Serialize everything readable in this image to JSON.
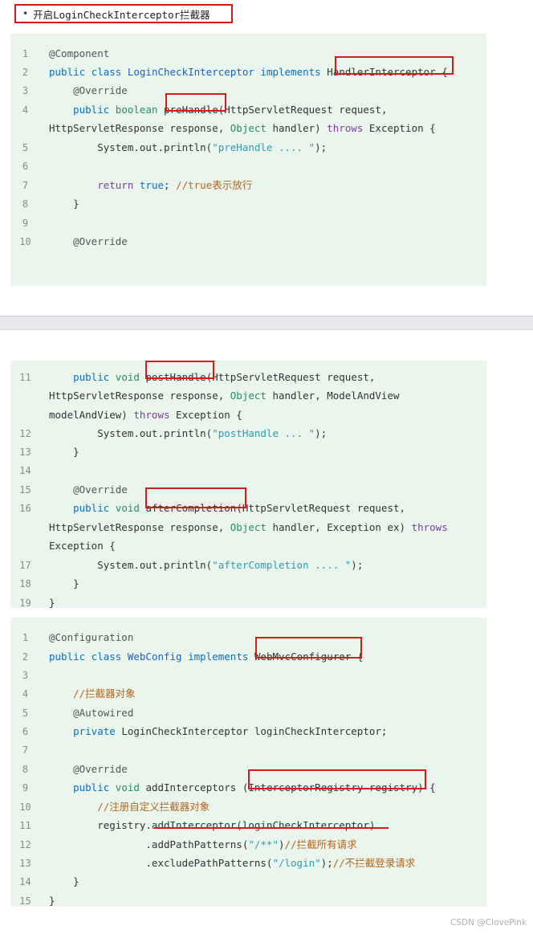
{
  "header": {
    "bullet": "•",
    "text": "开启LoginCheckInterceptor拦截器"
  },
  "block1": [
    {
      "n": "1",
      "parts": [
        [
          "ann",
          "@Component"
        ]
      ]
    },
    {
      "n": "2",
      "parts": [
        [
          "kw2",
          "public "
        ],
        [
          "kw2",
          "class "
        ],
        [
          "cls",
          "LoginCheckInterceptor "
        ],
        [
          "kw2",
          "implements "
        ],
        [
          "plain",
          "HandlerInterceptor"
        ],
        [
          "plain",
          " {"
        ]
      ]
    },
    {
      "n": "3",
      "parts": [
        [
          "ann",
          "    @Override"
        ]
      ]
    },
    {
      "n": "4",
      "parts": [
        [
          "kw2",
          "    public "
        ],
        [
          "ty",
          "boolean "
        ],
        [
          "plain",
          "preHandle"
        ],
        [
          "plain",
          "(HttpServletRequest request,"
        ]
      ]
    },
    {
      "n": "",
      "parts": [
        [
          "plain",
          "HttpServletResponse response, "
        ],
        [
          "ty",
          "Object "
        ],
        [
          "plain",
          "handler) "
        ],
        [
          "kw",
          "throws "
        ],
        [
          "plain",
          "Exception {"
        ]
      ]
    },
    {
      "n": "5",
      "parts": [
        [
          "plain",
          "        System.out.println("
        ],
        [
          "str",
          "\"preHandle .... \""
        ],
        [
          "plain",
          ");"
        ]
      ]
    },
    {
      "n": "6",
      "parts": []
    },
    {
      "n": "7",
      "parts": [
        [
          "kw",
          "        return "
        ],
        [
          "kw2",
          "true"
        ],
        [
          "plain",
          "; "
        ],
        [
          "cm",
          "//true表示放行"
        ]
      ]
    },
    {
      "n": "8",
      "parts": [
        [
          "plain",
          "    }"
        ]
      ]
    },
    {
      "n": "9",
      "parts": []
    },
    {
      "n": "10",
      "parts": [
        [
          "ann",
          "    @Override"
        ]
      ]
    }
  ],
  "block2": [
    {
      "n": "11",
      "parts": [
        [
          "kw2",
          "    public "
        ],
        [
          "ty",
          "void "
        ],
        [
          "plain",
          "postHandle"
        ],
        [
          "plain",
          "(HttpServletRequest request,"
        ]
      ]
    },
    {
      "n": "",
      "parts": [
        [
          "plain",
          "HttpServletResponse response, "
        ],
        [
          "ty",
          "Object "
        ],
        [
          "plain",
          "handler, ModelAndView"
        ]
      ]
    },
    {
      "n": "",
      "parts": [
        [
          "plain",
          "modelAndView) "
        ],
        [
          "kw",
          "throws "
        ],
        [
          "plain",
          "Exception {"
        ]
      ]
    },
    {
      "n": "12",
      "parts": [
        [
          "plain",
          "        System.out.println("
        ],
        [
          "str",
          "\"postHandle ... \""
        ],
        [
          "plain",
          ");"
        ]
      ]
    },
    {
      "n": "13",
      "parts": [
        [
          "plain",
          "    }"
        ]
      ]
    },
    {
      "n": "14",
      "parts": []
    },
    {
      "n": "15",
      "parts": [
        [
          "ann",
          "    @Override"
        ]
      ]
    },
    {
      "n": "16",
      "parts": [
        [
          "kw2",
          "    public "
        ],
        [
          "ty",
          "void "
        ],
        [
          "plain",
          "afterCompletion"
        ],
        [
          "plain",
          "(HttpServletRequest request,"
        ]
      ]
    },
    {
      "n": "",
      "parts": [
        [
          "plain",
          "HttpServletResponse response, "
        ],
        [
          "ty",
          "Object "
        ],
        [
          "plain",
          "handler, Exception ex) "
        ],
        [
          "kw",
          "throws"
        ]
      ]
    },
    {
      "n": "",
      "parts": [
        [
          "plain",
          "Exception {"
        ]
      ]
    },
    {
      "n": "17",
      "parts": [
        [
          "plain",
          "        System.out.println("
        ],
        [
          "str",
          "\"afterCompletion .... \""
        ],
        [
          "plain",
          ");"
        ]
      ]
    },
    {
      "n": "18",
      "parts": [
        [
          "plain",
          "    }"
        ]
      ]
    },
    {
      "n": "19",
      "parts": [
        [
          "plain",
          "}"
        ]
      ]
    }
  ],
  "block3": [
    {
      "n": "1",
      "parts": [
        [
          "ann",
          "@Configuration"
        ]
      ]
    },
    {
      "n": "2",
      "parts": [
        [
          "kw2",
          "public "
        ],
        [
          "kw2",
          "class "
        ],
        [
          "cls",
          "WebConfig "
        ],
        [
          "kw2",
          "implements "
        ],
        [
          "plain",
          "WebMvcConfigurer"
        ],
        [
          "plain",
          " {"
        ]
      ]
    },
    {
      "n": "3",
      "parts": []
    },
    {
      "n": "4",
      "parts": [
        [
          "cm",
          "    //拦截器对象"
        ]
      ]
    },
    {
      "n": "5",
      "parts": [
        [
          "ann",
          "    @Autowired"
        ]
      ]
    },
    {
      "n": "6",
      "parts": [
        [
          "kw2",
          "    private "
        ],
        [
          "plain",
          "LoginCheckInterceptor loginCheckInterceptor;"
        ]
      ]
    },
    {
      "n": "7",
      "parts": []
    },
    {
      "n": "8",
      "parts": [
        [
          "ann",
          "    @Override"
        ]
      ]
    },
    {
      "n": "9",
      "parts": [
        [
          "kw2",
          "    public "
        ],
        [
          "ty",
          "void "
        ],
        [
          "plain",
          "addInterceptors "
        ],
        [
          "plain",
          "(InterceptorRegistry registry"
        ],
        [
          "plain",
          ") {"
        ]
      ]
    },
    {
      "n": "10",
      "parts": [
        [
          "cm",
          "        //注册自定义拦截器对象"
        ]
      ]
    },
    {
      "n": "11",
      "parts": [
        [
          "plain",
          "        registry.addInterceptor(loginCheckInterceptor)"
        ]
      ]
    },
    {
      "n": "12",
      "parts": [
        [
          "plain",
          "                .addPathPatterns("
        ],
        [
          "str",
          "\"/**\""
        ],
        [
          "plain",
          ")"
        ],
        [
          "cm",
          "//拦截所有请求"
        ]
      ]
    },
    {
      "n": "13",
      "parts": [
        [
          "plain",
          "                .excludePathPatterns("
        ],
        [
          "str",
          "\"/login\""
        ],
        [
          "plain",
          ");"
        ],
        [
          "cm",
          "//不拦截登录请求"
        ]
      ]
    },
    {
      "n": "14",
      "parts": [
        [
          "plain",
          "    }"
        ]
      ]
    },
    {
      "n": "15",
      "parts": [
        [
          "plain",
          "}"
        ]
      ]
    }
  ],
  "watermark": "CSDN @CIovePink"
}
